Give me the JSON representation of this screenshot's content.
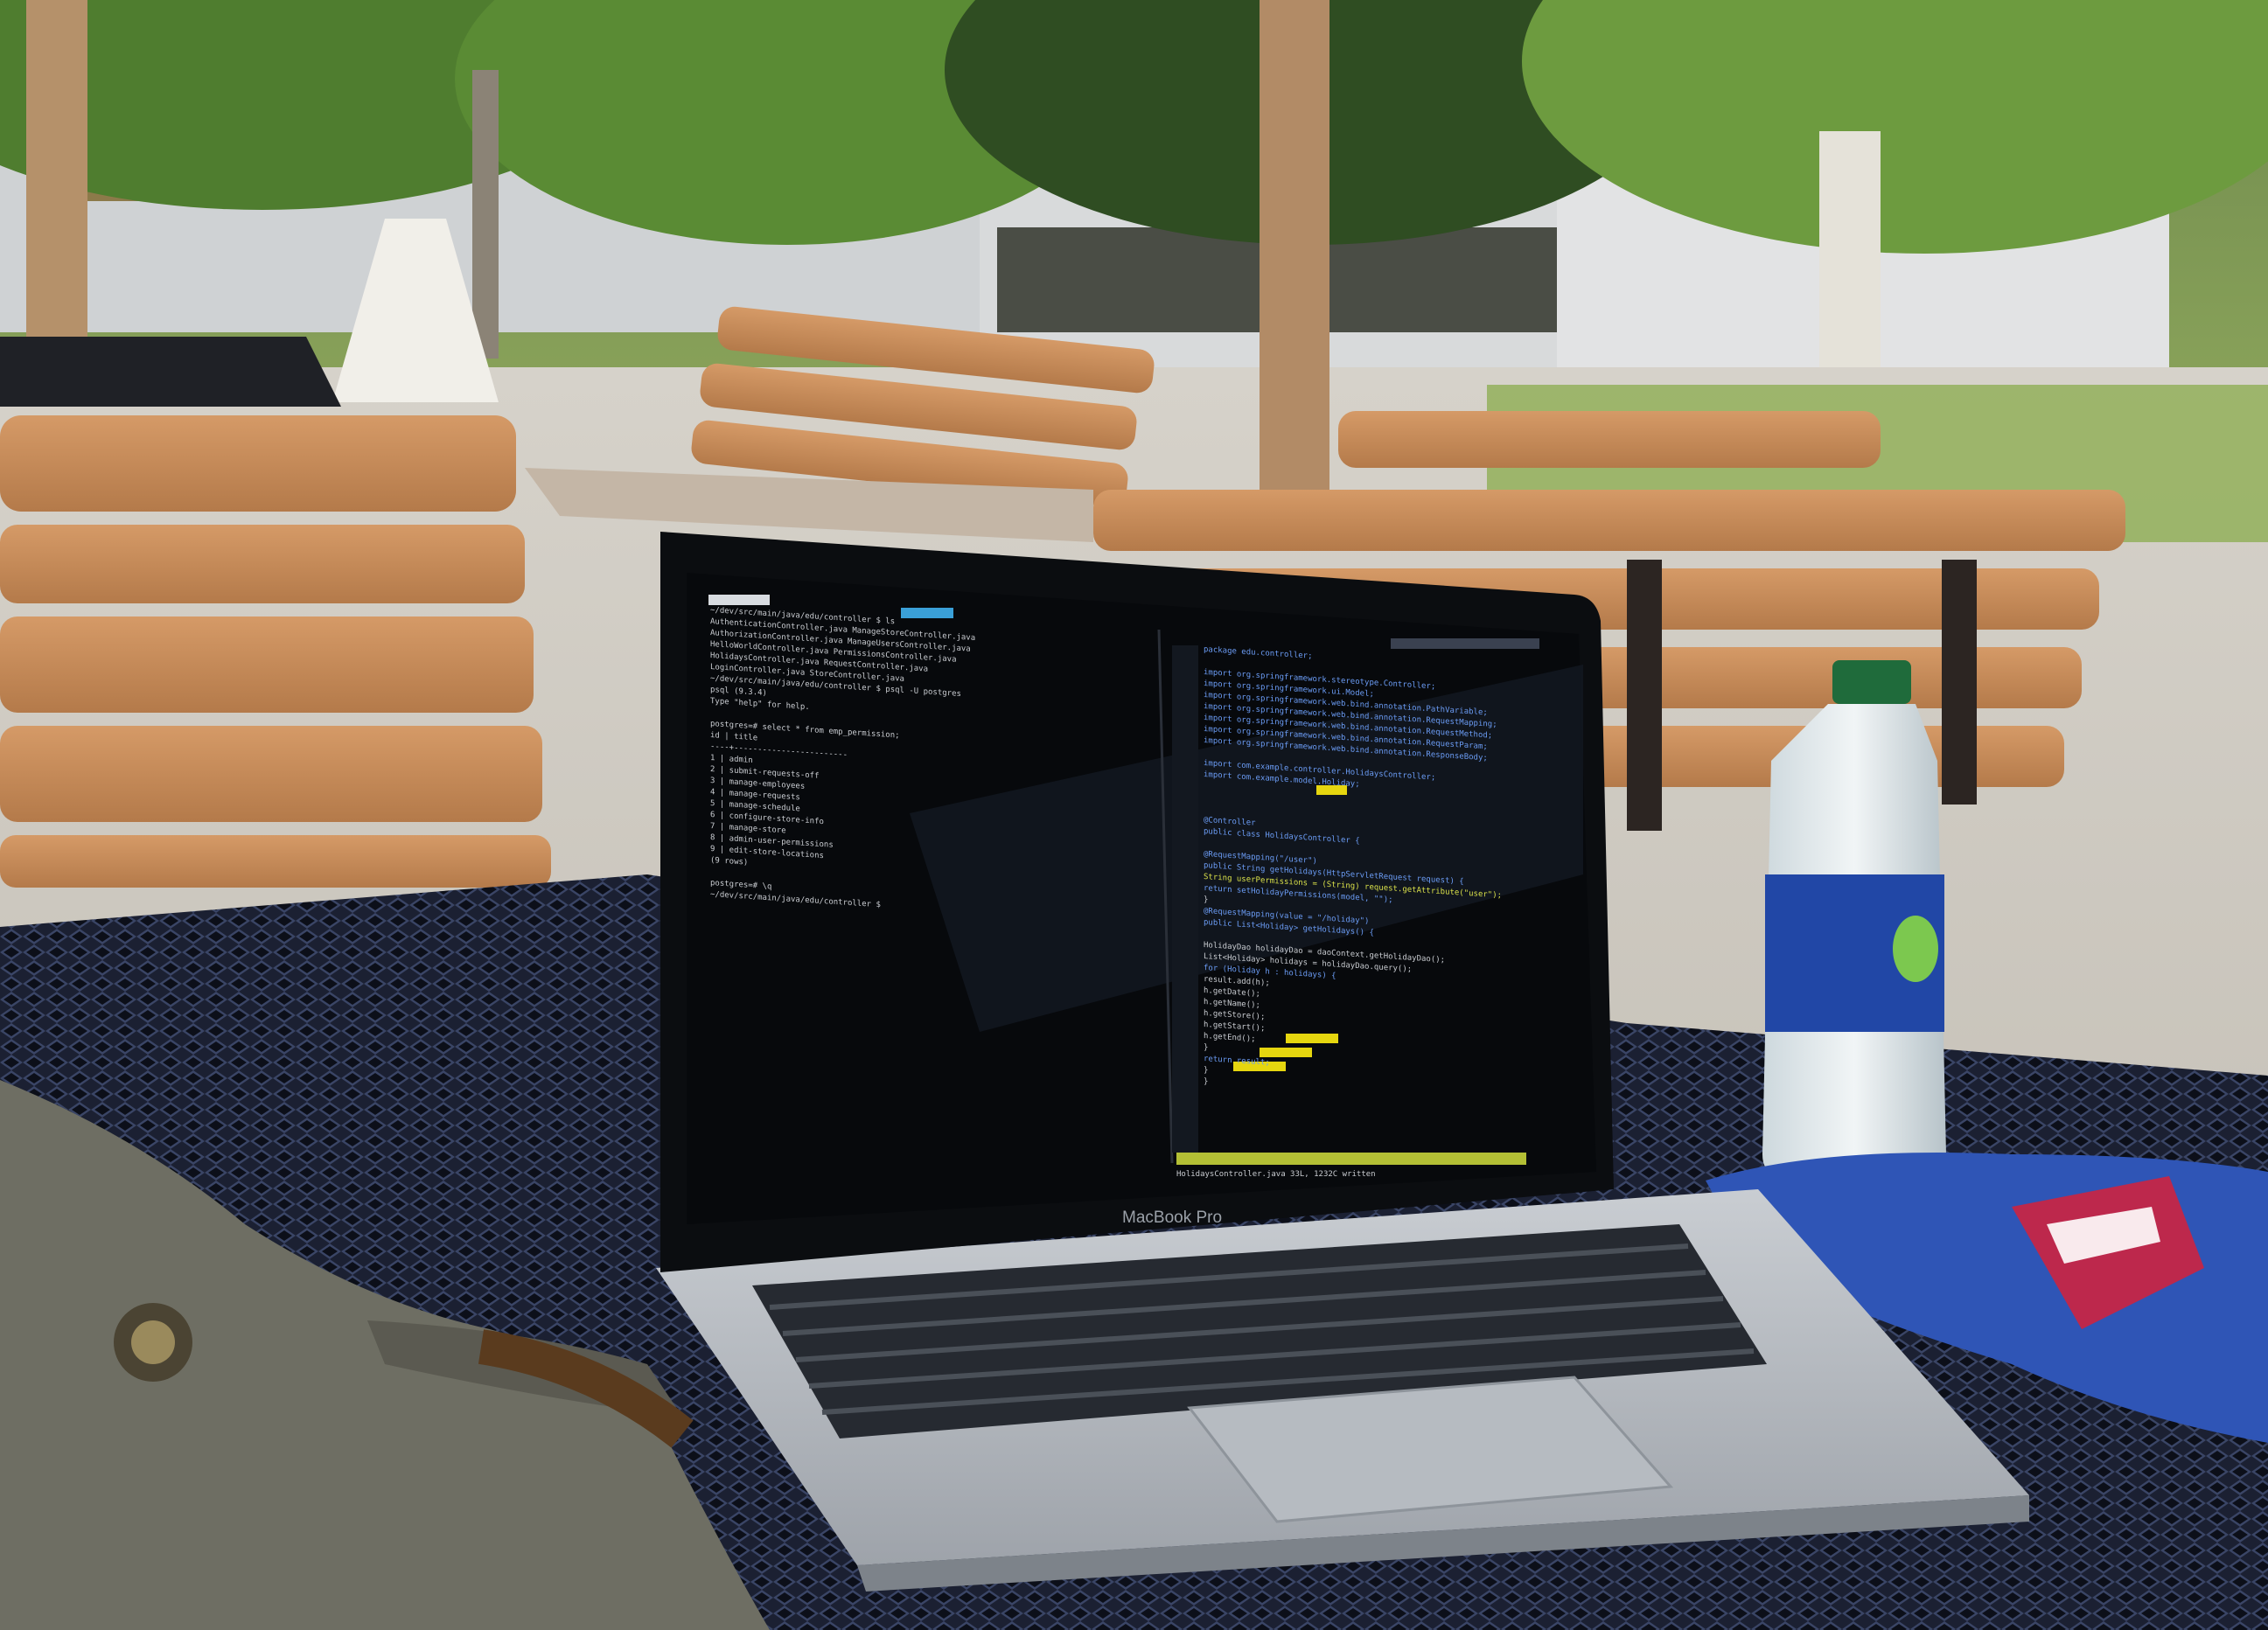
{
  "laptop": {
    "brand_label": "MacBook Pro"
  },
  "terminal_left": {
    "lines": [
      "~/dev/src/main/java/edu/controller $ ls",
      "AuthenticationController.java    ManageStoreController.java",
      "AuthorizationController.java     ManageUsersController.java",
      "HelloWorldController.java        PermissionsController.java",
      "HolidaysController.java          RequestController.java",
      "LoginController.java             StoreController.java",
      "~/dev/src/main/java/edu/controller $ psql -U postgres",
      "psql (9.3.4)",
      "Type \"help\" for help.",
      "",
      "postgres=# select * from emp_permission;",
      " id |         title",
      "----+------------------------",
      "  1 | admin",
      "  2 | submit-requests-off",
      "  3 | manage-employees",
      "  4 | manage-requests",
      "  5 | manage-schedule",
      "  6 | configure-store-info",
      "  7 | manage-store",
      "  8 | admin-user-permissions",
      "  9 | edit-store-locations",
      "(9 rows)",
      "",
      "postgres=# \\q",
      "~/dev/src/main/java/edu/controller $"
    ]
  },
  "editor_right": {
    "lines": [
      "package edu.controller;",
      "",
      "import org.springframework.stereotype.Controller;",
      "import org.springframework.ui.Model;",
      "import org.springframework.web.bind.annotation.PathVariable;",
      "import org.springframework.web.bind.annotation.RequestMapping;",
      "import org.springframework.web.bind.annotation.RequestMethod;",
      "import org.springframework.web.bind.annotation.RequestParam;",
      "import org.springframework.web.bind.annotation.ResponseBody;",
      "",
      "import com.example.controller.HolidaysController;",
      "import com.example.model.Holiday;",
      "",
      "",
      "",
      "@Controller",
      "public class HolidaysController {",
      "",
      "  @RequestMapping(\"/user\")",
      "  public String getHolidays(HttpServletRequest request) {",
      "    String userPermissions = (String) request.getAttribute(\"user\");",
      "    return setHolidayPermissions(model, \"\");",
      "  }",
      "  @RequestMapping(value = \"/holiday\")",
      "  public List<Holiday> getHolidays() {",
      "",
      "    HolidayDao holidayDao = daoContext.getHolidayDao();",
      "    List<Holiday> holidays = holidayDao.query();",
      "    for (Holiday h : holidays) {",
      "      result.add(h);",
      "      h.getDate();",
      "      h.getName();",
      "      h.getStore();",
      "      h.getStart();",
      "      h.getEnd();",
      "    }",
      "    return result;",
      "  }",
      "}"
    ],
    "status_line": "HolidaysController.java  33L, 1232C written"
  },
  "colors": {
    "terminal_bg": "#07090c",
    "terminal_text": "#c9ccd1",
    "keyword": "#6b9cf5",
    "string": "#d9e04a",
    "highlight": "#e6d60f",
    "bench_wood": "#c58a5a",
    "table_mesh": "#1d2236",
    "chip_bag": "#2f55b6"
  }
}
